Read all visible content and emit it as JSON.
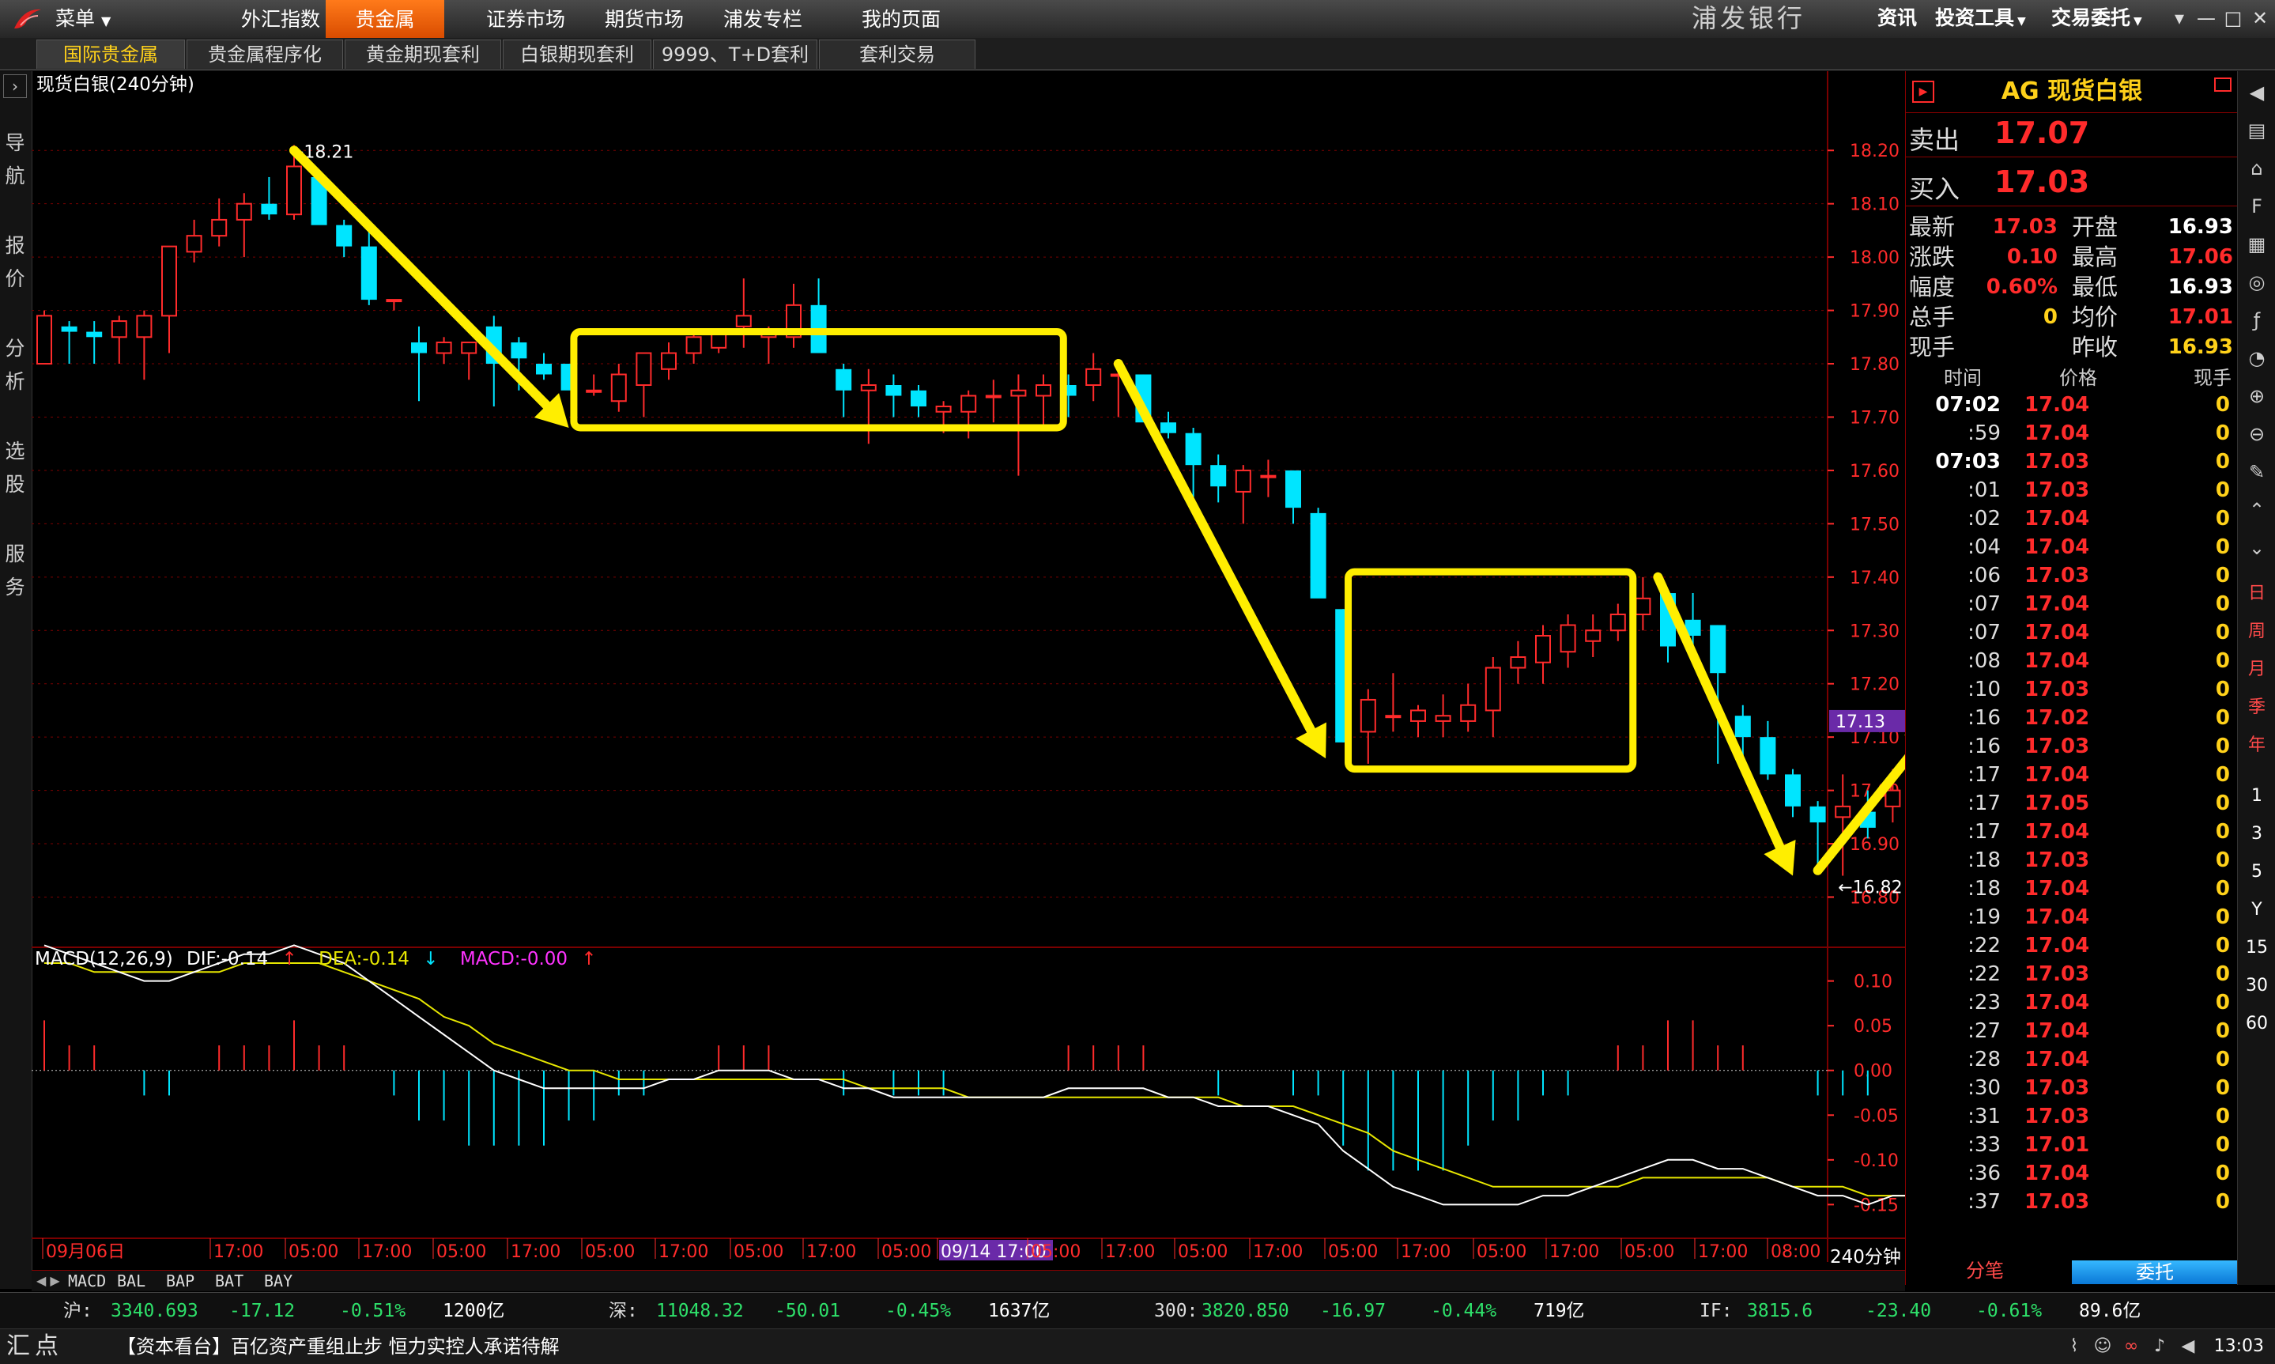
{
  "app": {
    "menu_label": "菜单",
    "nav": [
      "外汇指数",
      "贵金属",
      "证券市场",
      "期货市场",
      "浦发专栏",
      "我的页面"
    ],
    "nav_active": 1,
    "bank_name": "浦发银行",
    "tools": [
      "资讯",
      "投资工具",
      "交易委托"
    ],
    "window_buttons": [
      "▾",
      "—",
      "□",
      "✕"
    ]
  },
  "subtabs": [
    "国际贵金属",
    "贵金属程序化",
    "黄金期现套利",
    "白银期现套利",
    "9999、T+D套利",
    "套利交易"
  ],
  "subtab_active": 0,
  "leftnav": [
    "导航",
    "报价",
    "分析",
    "选股",
    "服务"
  ],
  "chart": {
    "title": "现货白银(240分钟)",
    "period": "240分钟",
    "y_ticks": [
      "18.20",
      "18.10",
      "18.00",
      "17.90",
      "17.80",
      "17.70",
      "17.60",
      "17.50",
      "17.40",
      "17.30",
      "17.20",
      "17.10",
      "17.00",
      "16.90",
      "16.80"
    ],
    "current_price_tag": "17.13",
    "high_label": "18.21",
    "low_label": "16.82",
    "x_labels": [
      "09月06日",
      "17:00",
      "05:00",
      "17:00",
      "05:00",
      "17:00",
      "05:00",
      "17:00",
      "05:00",
      "17:00",
      "05:00",
      "09/14 17:00",
      "05:00",
      "17:00",
      "05:00",
      "17:00",
      "05:00",
      "17:00",
      "05:00",
      "17:00",
      "05:00",
      "17:00",
      "08:00"
    ],
    "macd_ticks": [
      "0.10",
      "0.05",
      "0.00",
      "-0.05",
      "-0.10",
      "-0.15"
    ],
    "macd_legend": {
      "name": "MACD(12,26,9)",
      "dif": "DIF:-0.14",
      "dea": "DEA:-0.14",
      "macd": "MACD:-0.00"
    },
    "indicator_tabs": [
      "MACD",
      "BAL",
      "BAP",
      "BAT",
      "BAY"
    ],
    "colors": {
      "up": "#ff2b2b",
      "down": "#00e5ff",
      "annotation": "#ffee00",
      "grid": "#7a0000",
      "dif": "#ffffff",
      "dea": "#e6e600",
      "macd_label": "#ff33ff"
    }
  },
  "chart_data": {
    "type": "candlestick",
    "title": "现货白银(240分钟)",
    "ylim": [
      16.78,
      18.23
    ],
    "candles": [
      {
        "o": 17.8,
        "h": 17.9,
        "l": 17.8,
        "c": 17.89
      },
      {
        "o": 17.87,
        "h": 17.88,
        "l": 17.8,
        "c": 17.86
      },
      {
        "o": 17.86,
        "h": 17.88,
        "l": 17.8,
        "c": 17.85
      },
      {
        "o": 17.85,
        "h": 17.89,
        "l": 17.8,
        "c": 17.88
      },
      {
        "o": 17.85,
        "h": 17.9,
        "l": 17.77,
        "c": 17.89
      },
      {
        "o": 17.89,
        "h": 18.02,
        "l": 17.82,
        "c": 18.02
      },
      {
        "o": 18.01,
        "h": 18.07,
        "l": 17.99,
        "c": 18.04
      },
      {
        "o": 18.04,
        "h": 18.11,
        "l": 18.02,
        "c": 18.07
      },
      {
        "o": 18.07,
        "h": 18.12,
        "l": 18.0,
        "c": 18.1
      },
      {
        "o": 18.1,
        "h": 18.15,
        "l": 18.07,
        "c": 18.08
      },
      {
        "o": 18.08,
        "h": 18.21,
        "l": 18.07,
        "c": 18.17
      },
      {
        "o": 18.15,
        "h": 18.16,
        "l": 18.07,
        "c": 18.06
      },
      {
        "o": 18.06,
        "h": 18.07,
        "l": 18.0,
        "c": 18.02
      },
      {
        "o": 18.02,
        "h": 18.05,
        "l": 17.91,
        "c": 17.92
      },
      {
        "o": 17.92,
        "h": 17.92,
        "l": 17.9,
        "c": 17.92
      },
      {
        "o": 17.84,
        "h": 17.87,
        "l": 17.73,
        "c": 17.82
      },
      {
        "o": 17.82,
        "h": 17.85,
        "l": 17.8,
        "c": 17.84
      },
      {
        "o": 17.82,
        "h": 17.84,
        "l": 17.77,
        "c": 17.84
      },
      {
        "o": 17.87,
        "h": 17.89,
        "l": 17.72,
        "c": 17.8
      },
      {
        "o": 17.84,
        "h": 17.85,
        "l": 17.75,
        "c": 17.81
      },
      {
        "o": 17.8,
        "h": 17.82,
        "l": 17.77,
        "c": 17.78
      },
      {
        "o": 17.8,
        "h": 17.8,
        "l": 17.76,
        "c": 17.75
      },
      {
        "o": 17.75,
        "h": 17.78,
        "l": 17.74,
        "c": 17.75
      },
      {
        "o": 17.73,
        "h": 17.8,
        "l": 17.71,
        "c": 17.78
      },
      {
        "o": 17.76,
        "h": 17.82,
        "l": 17.7,
        "c": 17.82
      },
      {
        "o": 17.79,
        "h": 17.84,
        "l": 17.77,
        "c": 17.82
      },
      {
        "o": 17.82,
        "h": 17.86,
        "l": 17.8,
        "c": 17.85
      },
      {
        "o": 17.83,
        "h": 17.86,
        "l": 17.82,
        "c": 17.86
      },
      {
        "o": 17.87,
        "h": 17.96,
        "l": 17.83,
        "c": 17.89
      },
      {
        "o": 17.85,
        "h": 17.87,
        "l": 17.8,
        "c": 17.86
      },
      {
        "o": 17.85,
        "h": 17.95,
        "l": 17.83,
        "c": 17.91
      },
      {
        "o": 17.91,
        "h": 17.96,
        "l": 17.85,
        "c": 17.82
      },
      {
        "o": 17.79,
        "h": 17.8,
        "l": 17.7,
        "c": 17.75
      },
      {
        "o": 17.75,
        "h": 17.79,
        "l": 17.65,
        "c": 17.76
      },
      {
        "o": 17.76,
        "h": 17.78,
        "l": 17.7,
        "c": 17.74
      },
      {
        "o": 17.75,
        "h": 17.76,
        "l": 17.7,
        "c": 17.72
      },
      {
        "o": 17.71,
        "h": 17.73,
        "l": 17.67,
        "c": 17.72
      },
      {
        "o": 17.71,
        "h": 17.75,
        "l": 17.66,
        "c": 17.74
      },
      {
        "o": 17.74,
        "h": 17.77,
        "l": 17.69,
        "c": 17.74
      },
      {
        "o": 17.74,
        "h": 17.78,
        "l": 17.59,
        "c": 17.75
      },
      {
        "o": 17.74,
        "h": 17.78,
        "l": 17.68,
        "c": 17.76
      },
      {
        "o": 17.76,
        "h": 17.78,
        "l": 17.7,
        "c": 17.74
      },
      {
        "o": 17.76,
        "h": 17.82,
        "l": 17.73,
        "c": 17.79
      },
      {
        "o": 17.78,
        "h": 17.8,
        "l": 17.7,
        "c": 17.78
      },
      {
        "o": 17.78,
        "h": 17.78,
        "l": 17.7,
        "c": 17.69
      },
      {
        "o": 17.69,
        "h": 17.71,
        "l": 17.66,
        "c": 17.67
      },
      {
        "o": 17.67,
        "h": 17.68,
        "l": 17.55,
        "c": 17.61
      },
      {
        "o": 17.61,
        "h": 17.63,
        "l": 17.54,
        "c": 17.57
      },
      {
        "o": 17.56,
        "h": 17.61,
        "l": 17.5,
        "c": 17.6
      },
      {
        "o": 17.59,
        "h": 17.62,
        "l": 17.55,
        "c": 17.59
      },
      {
        "o": 17.6,
        "h": 17.6,
        "l": 17.5,
        "c": 17.53
      },
      {
        "o": 17.52,
        "h": 17.53,
        "l": 17.37,
        "c": 17.36
      },
      {
        "o": 17.34,
        "h": 17.34,
        "l": 17.09,
        "c": 17.09
      },
      {
        "o": 17.11,
        "h": 17.19,
        "l": 17.05,
        "c": 17.17
      },
      {
        "o": 17.14,
        "h": 17.22,
        "l": 17.11,
        "c": 17.14
      },
      {
        "o": 17.13,
        "h": 17.16,
        "l": 17.1,
        "c": 17.15
      },
      {
        "o": 17.13,
        "h": 17.18,
        "l": 17.1,
        "c": 17.14
      },
      {
        "o": 17.13,
        "h": 17.2,
        "l": 17.11,
        "c": 17.16
      },
      {
        "o": 17.15,
        "h": 17.25,
        "l": 17.1,
        "c": 17.23
      },
      {
        "o": 17.23,
        "h": 17.28,
        "l": 17.2,
        "c": 17.25
      },
      {
        "o": 17.24,
        "h": 17.31,
        "l": 17.2,
        "c": 17.29
      },
      {
        "o": 17.26,
        "h": 17.33,
        "l": 17.23,
        "c": 17.31
      },
      {
        "o": 17.28,
        "h": 17.33,
        "l": 17.25,
        "c": 17.3
      },
      {
        "o": 17.3,
        "h": 17.35,
        "l": 17.28,
        "c": 17.33
      },
      {
        "o": 17.33,
        "h": 17.4,
        "l": 17.3,
        "c": 17.36
      },
      {
        "o": 17.37,
        "h": 17.37,
        "l": 17.24,
        "c": 17.27
      },
      {
        "o": 17.32,
        "h": 17.37,
        "l": 17.24,
        "c": 17.29
      },
      {
        "o": 17.31,
        "h": 17.31,
        "l": 17.05,
        "c": 17.22
      },
      {
        "o": 17.14,
        "h": 17.16,
        "l": 17.03,
        "c": 17.1
      },
      {
        "o": 17.1,
        "h": 17.13,
        "l": 17.02,
        "c": 17.03
      },
      {
        "o": 17.03,
        "h": 17.04,
        "l": 16.95,
        "c": 16.97
      },
      {
        "o": 16.97,
        "h": 16.98,
        "l": 16.85,
        "c": 16.94
      },
      {
        "o": 16.95,
        "h": 17.03,
        "l": 16.84,
        "c": 16.97
      },
      {
        "o": 16.96,
        "h": 17.0,
        "l": 16.91,
        "c": 16.93
      },
      {
        "o": 16.97,
        "h": 17.04,
        "l": 16.94,
        "c": 17.0
      },
      {
        "o": 17.02,
        "h": 17.06,
        "l": 16.97,
        "c": 17.03
      }
    ],
    "dif": [
      0.14,
      0.13,
      0.12,
      0.11,
      0.1,
      0.1,
      0.11,
      0.12,
      0.13,
      0.13,
      0.14,
      0.13,
      0.12,
      0.1,
      0.08,
      0.06,
      0.04,
      0.02,
      0.0,
      -0.01,
      -0.02,
      -0.02,
      -0.02,
      -0.02,
      -0.02,
      -0.01,
      -0.01,
      0.0,
      0.0,
      0.0,
      -0.01,
      -0.01,
      -0.02,
      -0.02,
      -0.03,
      -0.03,
      -0.03,
      -0.03,
      -0.03,
      -0.03,
      -0.03,
      -0.02,
      -0.02,
      -0.02,
      -0.02,
      -0.03,
      -0.03,
      -0.04,
      -0.04,
      -0.04,
      -0.05,
      -0.06,
      -0.09,
      -0.11,
      -0.13,
      -0.14,
      -0.15,
      -0.15,
      -0.15,
      -0.15,
      -0.14,
      -0.14,
      -0.13,
      -0.12,
      -0.11,
      -0.1,
      -0.1,
      -0.11,
      -0.11,
      -0.12,
      -0.13,
      -0.14,
      -0.14,
      -0.15,
      -0.14,
      -0.14
    ],
    "dea": [
      0.12,
      0.12,
      0.11,
      0.11,
      0.11,
      0.11,
      0.11,
      0.11,
      0.12,
      0.12,
      0.12,
      0.12,
      0.11,
      0.1,
      0.09,
      0.08,
      0.06,
      0.05,
      0.03,
      0.02,
      0.01,
      0.0,
      0.0,
      -0.01,
      -0.01,
      -0.01,
      -0.01,
      -0.01,
      -0.01,
      -0.01,
      -0.01,
      -0.01,
      -0.01,
      -0.02,
      -0.02,
      -0.02,
      -0.02,
      -0.03,
      -0.03,
      -0.03,
      -0.03,
      -0.03,
      -0.03,
      -0.03,
      -0.03,
      -0.03,
      -0.03,
      -0.03,
      -0.04,
      -0.04,
      -0.04,
      -0.05,
      -0.06,
      -0.07,
      -0.09,
      -0.1,
      -0.11,
      -0.12,
      -0.13,
      -0.13,
      -0.13,
      -0.13,
      -0.13,
      -0.13,
      -0.12,
      -0.12,
      -0.12,
      -0.12,
      -0.12,
      -0.12,
      -0.13,
      -0.13,
      -0.13,
      -0.14,
      -0.14,
      -0.14
    ]
  },
  "quote": {
    "symbol": "AG 现货白银",
    "sell_label": "卖出",
    "sell": "17.07",
    "buy_label": "买入",
    "buy": "17.03",
    "rows": [
      {
        "l1": "最新",
        "v1": "17.03",
        "l2": "开盘",
        "v2": "16.93",
        "c1": "#ff2b2b",
        "c2": "#ffffff"
      },
      {
        "l1": "涨跌",
        "v1": "0.10",
        "l2": "最高",
        "v2": "17.06",
        "c1": "#ff2b2b",
        "c2": "#ff2b2b"
      },
      {
        "l1": "幅度",
        "v1": "0.60%",
        "l2": "最低",
        "v2": "16.93",
        "c1": "#ff2b2b",
        "c2": "#ffffff"
      },
      {
        "l1": "总手",
        "v1": "0",
        "l2": "均价",
        "v2": "17.01",
        "c1": "#ffd11a",
        "c2": "#ff2b2b"
      },
      {
        "l1": "现手",
        "v1": "",
        "l2": "昨收",
        "v2": "16.93",
        "c1": "#ffd11a",
        "c2": "#ffd11a"
      }
    ],
    "tick_header": [
      "时间",
      "价格",
      "现手"
    ],
    "ticks": [
      {
        "t": "07:02",
        "p": "17.04",
        "h": "0"
      },
      {
        "t": ":59",
        "p": "17.04",
        "h": "0"
      },
      {
        "t": "07:03",
        "p": "17.03",
        "h": "0"
      },
      {
        "t": ":01",
        "p": "17.03",
        "h": "0"
      },
      {
        "t": ":02",
        "p": "17.04",
        "h": "0"
      },
      {
        "t": ":04",
        "p": "17.04",
        "h": "0"
      },
      {
        "t": ":06",
        "p": "17.03",
        "h": "0"
      },
      {
        "t": ":07",
        "p": "17.04",
        "h": "0"
      },
      {
        "t": ":07",
        "p": "17.04",
        "h": "0"
      },
      {
        "t": ":08",
        "p": "17.04",
        "h": "0"
      },
      {
        "t": ":10",
        "p": "17.03",
        "h": "0"
      },
      {
        "t": ":16",
        "p": "17.02",
        "h": "0"
      },
      {
        "t": ":16",
        "p": "17.03",
        "h": "0"
      },
      {
        "t": ":17",
        "p": "17.04",
        "h": "0"
      },
      {
        "t": ":17",
        "p": "17.05",
        "h": "0"
      },
      {
        "t": ":17",
        "p": "17.04",
        "h": "0"
      },
      {
        "t": ":18",
        "p": "17.03",
        "h": "0"
      },
      {
        "t": ":18",
        "p": "17.04",
        "h": "0"
      },
      {
        "t": ":19",
        "p": "17.04",
        "h": "0"
      },
      {
        "t": ":22",
        "p": "17.04",
        "h": "0"
      },
      {
        "t": ":22",
        "p": "17.03",
        "h": "0"
      },
      {
        "t": ":23",
        "p": "17.04",
        "h": "0"
      },
      {
        "t": ":27",
        "p": "17.04",
        "h": "0"
      },
      {
        "t": ":28",
        "p": "17.04",
        "h": "0"
      },
      {
        "t": ":30",
        "p": "17.03",
        "h": "0"
      },
      {
        "t": ":31",
        "p": "17.03",
        "h": "0"
      },
      {
        "t": ":33",
        "p": "17.01",
        "h": "0"
      },
      {
        "t": ":36",
        "p": "17.04",
        "h": "0"
      },
      {
        "t": ":37",
        "p": "17.03",
        "h": "0"
      }
    ],
    "detail_btn": "分笔",
    "delegate_btn": "委托"
  },
  "rtools": {
    "periods": [
      "日",
      "周",
      "月",
      "季",
      "年"
    ],
    "nums": [
      "1",
      "3",
      "5",
      "Y",
      "15",
      "30",
      "60"
    ]
  },
  "status": {
    "sh_label": "沪:",
    "sh_val": "3340.693",
    "sh_chg": "-17.12",
    "sh_pct": "-0.51%",
    "sh_amt": "1200亿",
    "sz_label": "深:",
    "sz_val": "11048.32",
    "sz_chg": "-50.01",
    "sz_pct": "-0.45%",
    "sz_amt": "1637亿",
    "hs_label": "300:",
    "hs_val": "3820.850",
    "hs_chg": "-16.97",
    "hs_pct": "-0.44%",
    "hs_amt": "719亿",
    "if_label": "IF:",
    "if_val": "3815.6",
    "if_chg": "-23.40",
    "if_pct": "-0.61%",
    "if_amt": "89.6亿"
  },
  "news": {
    "logo": "汇点",
    "text": "【资本看台】百亿资产重组止步 恒力实控人承诺待解",
    "clock": "13:03"
  }
}
